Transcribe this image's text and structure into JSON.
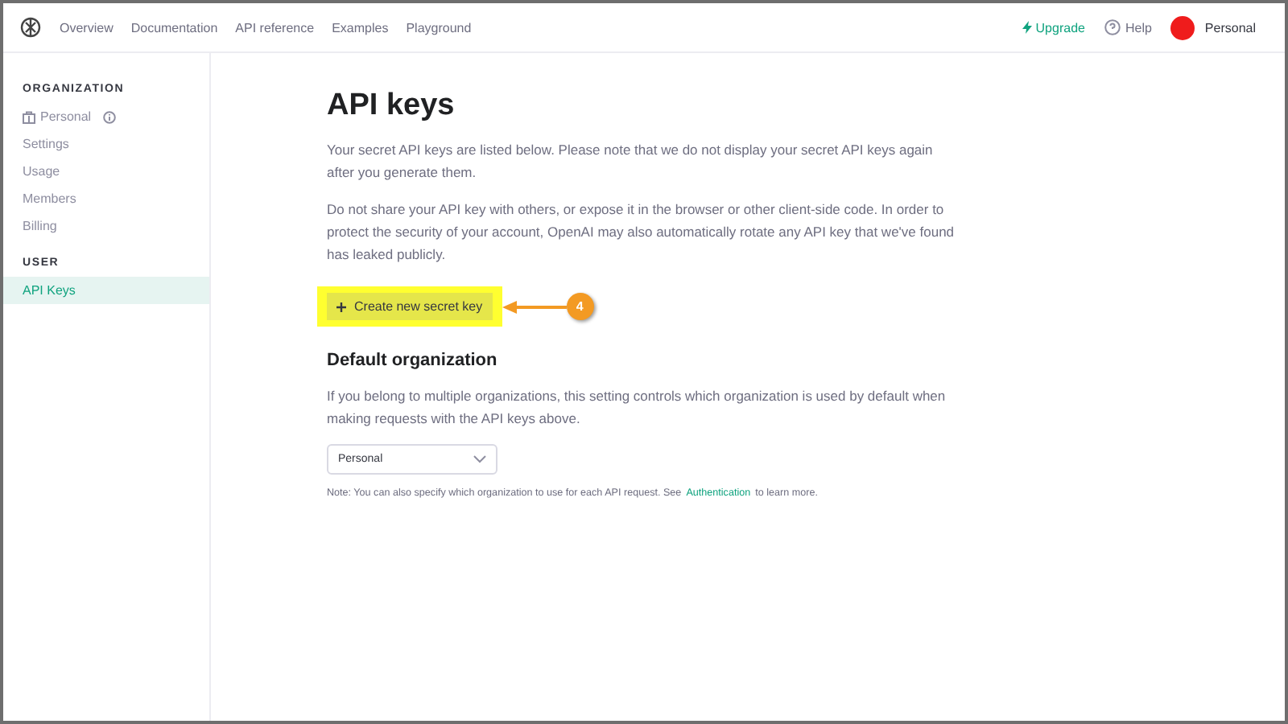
{
  "nav": {
    "links": [
      {
        "label": "Overview"
      },
      {
        "label": "Documentation"
      },
      {
        "label": "API reference"
      },
      {
        "label": "Examples"
      },
      {
        "label": "Playground"
      }
    ],
    "upgrade": "Upgrade",
    "help": "Help",
    "account": "Personal"
  },
  "sidebar": {
    "sections": [
      {
        "heading": "ORGANIZATION",
        "items": [
          {
            "label": "Personal",
            "kind": "org",
            "selected": false
          },
          {
            "label": "Settings",
            "kind": "link",
            "selected": false
          },
          {
            "label": "Usage",
            "kind": "link",
            "selected": false
          },
          {
            "label": "Members",
            "kind": "link",
            "selected": false
          },
          {
            "label": "Billing",
            "kind": "link",
            "selected": false
          }
        ]
      },
      {
        "heading": "USER",
        "items": [
          {
            "label": "API Keys",
            "kind": "link",
            "selected": true
          }
        ]
      }
    ]
  },
  "main": {
    "title": "API keys",
    "paragraphs": [
      "Your secret API keys are listed below. Please note that we do not display your secret API keys again after you generate them.",
      "Do not share your API key with others, or expose it in the browser or other client-side code. In order to protect the security of your account, OpenAI may also automatically rotate any API key that we've found has leaked publicly."
    ],
    "create_button": "Create new secret key",
    "callout": {
      "badge": "4"
    },
    "default_org": {
      "title": "Default organization",
      "description": "If you belong to multiple organizations, this setting controls which organization is used by default when making requests with the API keys above.",
      "select_value": "Personal",
      "note_before": "Note: You can also specify which organization to use for each API request. See",
      "note_link": "Authentication",
      "note_after": "to learn more."
    }
  }
}
